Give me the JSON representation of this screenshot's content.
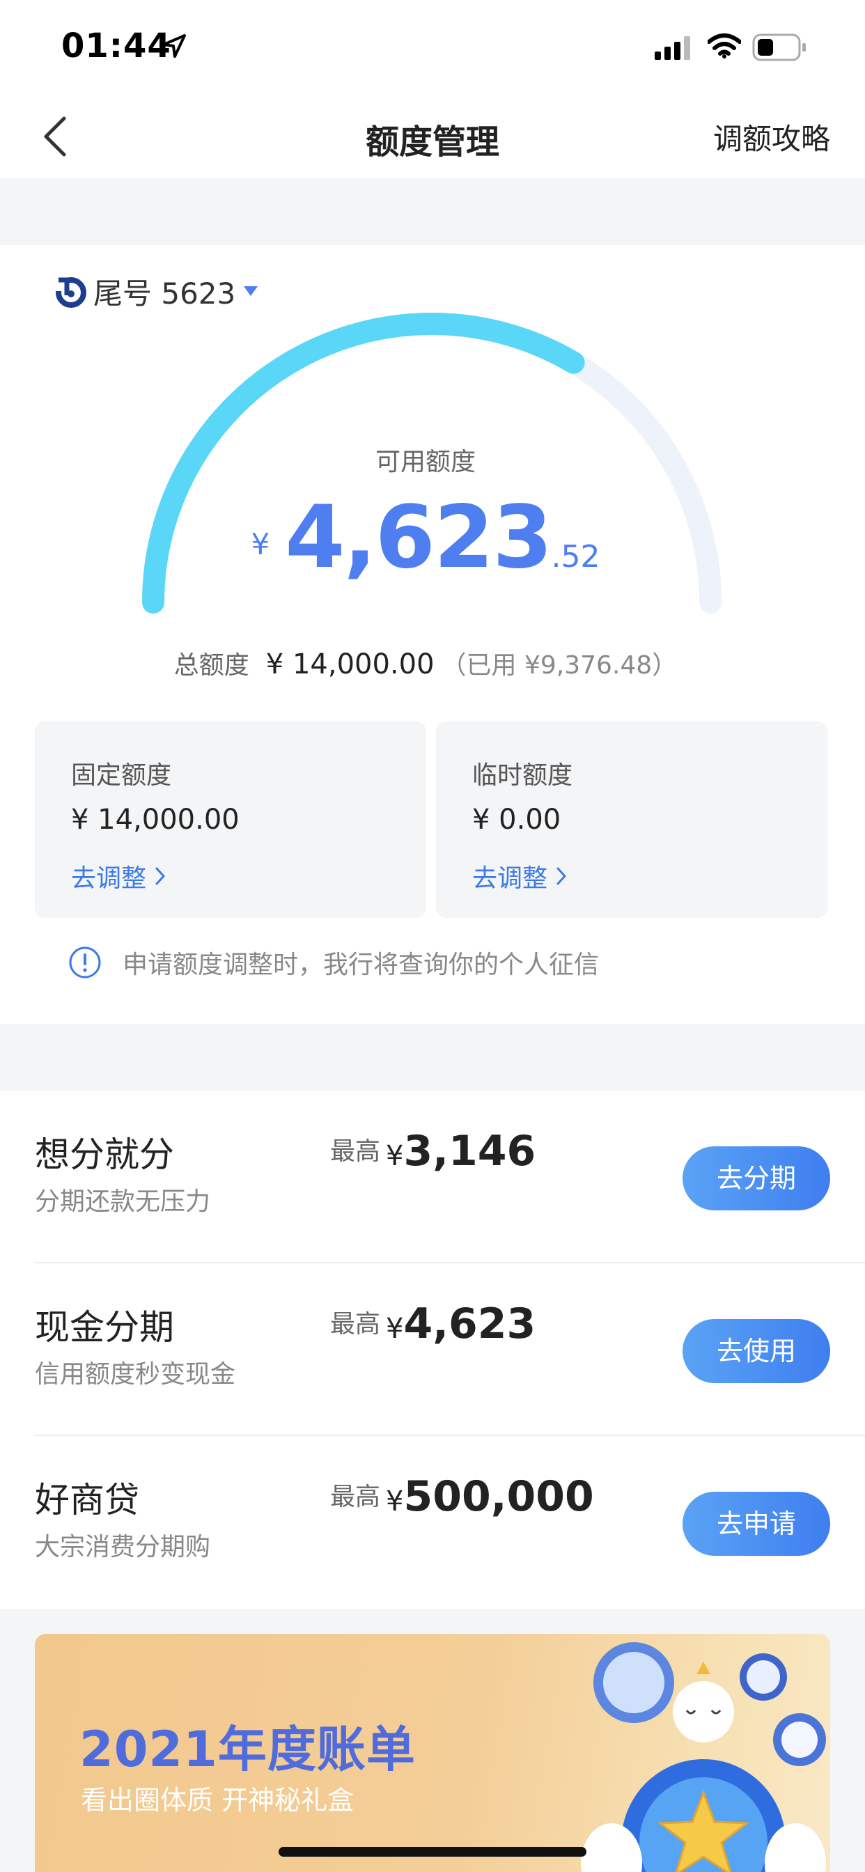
{
  "status_bar": {
    "time": "01:44"
  },
  "nav": {
    "title": "额度管理",
    "right_link": "调额攻略"
  },
  "card": {
    "tail_label": "尾号 5623"
  },
  "available": {
    "label": "可用额度",
    "currency": "¥",
    "integer": "4,623",
    "decimal": ".52",
    "used_fraction": 0.67
  },
  "total": {
    "label": "总额度",
    "value": "¥ 14,000.00",
    "used": "（已用 ¥9,376.48）"
  },
  "quota_boxes": [
    {
      "label": "固定额度",
      "value": "¥ 14,000.00",
      "action": "去调整"
    },
    {
      "label": "临时额度",
      "value": "¥ 0.00",
      "action": "去调整"
    }
  ],
  "notice": "申请额度调整时，我行将查询你的个人征信",
  "products": [
    {
      "title": "想分就分",
      "subtitle": "分期还款无压力",
      "max_label": "最高",
      "currency": "¥",
      "max_value": "3,146",
      "button": "去分期"
    },
    {
      "title": "现金分期",
      "subtitle": "信用额度秒变现金",
      "max_label": "最高",
      "currency": "¥",
      "max_value": "4,623",
      "button": "去使用"
    },
    {
      "title": "好商贷",
      "subtitle": "大宗消费分期购",
      "max_label": "最高",
      "currency": "¥",
      "max_value": "500,000",
      "button": "去申请"
    }
  ],
  "banner": {
    "title": "2021年度账单",
    "subtitle": "看出圈体质 开神秘礼盒"
  },
  "colors": {
    "accent": "#4f7ef0",
    "gauge_fill": "#5ad6f7",
    "gauge_track": "#eef2fb"
  }
}
